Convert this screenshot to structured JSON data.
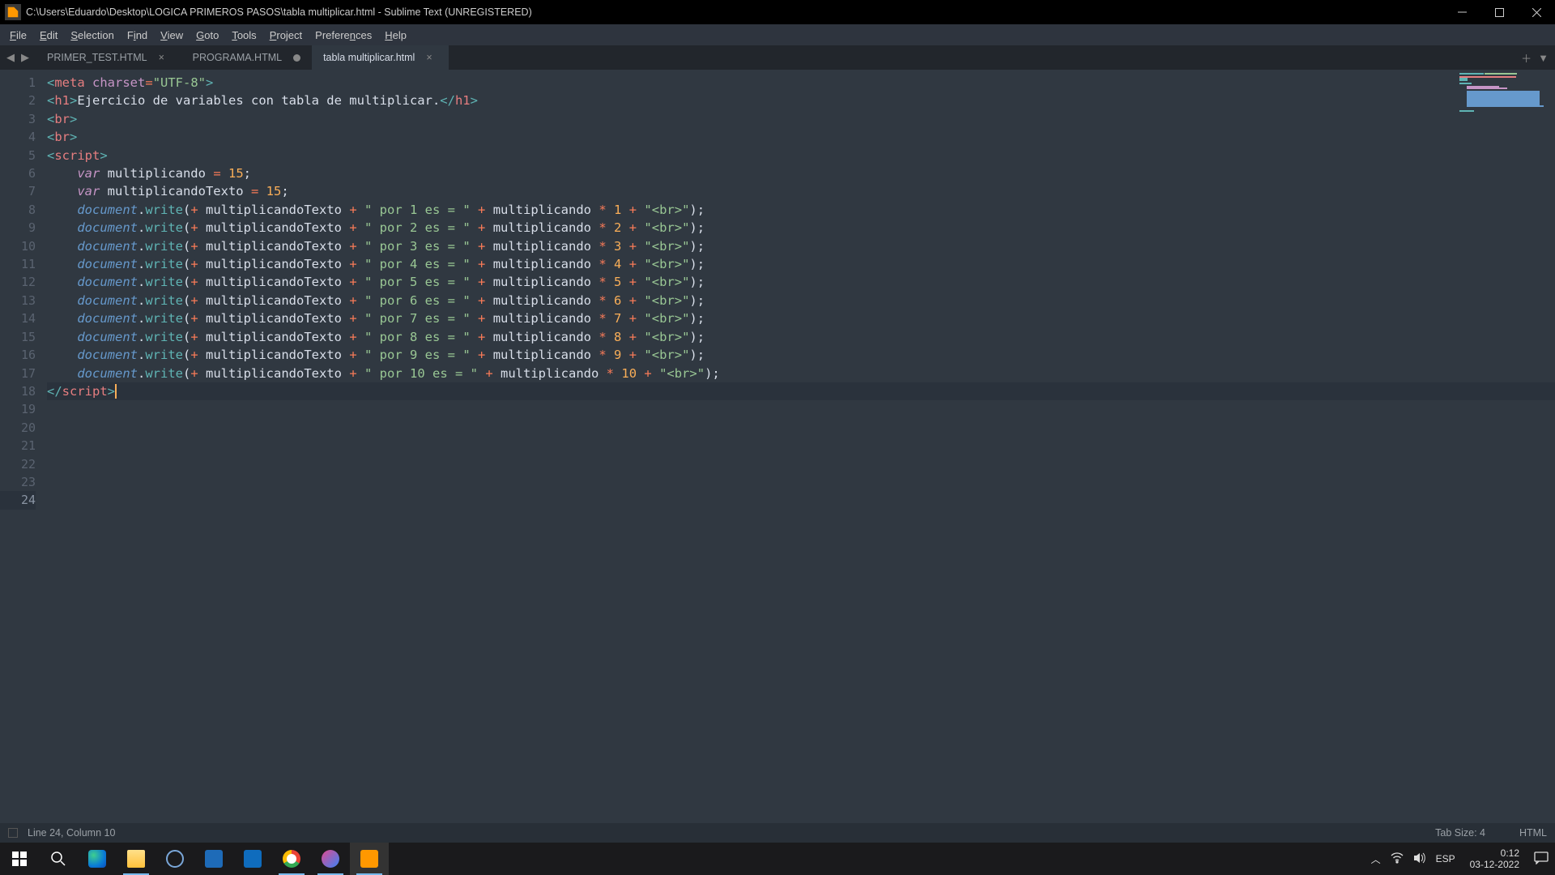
{
  "window": {
    "title": "C:\\Users\\Eduardo\\Desktop\\LOGICA PRIMEROS PASOS\\tabla multiplicar.html - Sublime Text (UNREGISTERED)"
  },
  "menu": [
    "File",
    "Edit",
    "Selection",
    "Find",
    "View",
    "Goto",
    "Tools",
    "Project",
    "Preferences",
    "Help"
  ],
  "tabs": [
    {
      "label": "PRIMER_TEST.HTML",
      "active": false,
      "dirty": false
    },
    {
      "label": "PROGRAMA.HTML",
      "active": false,
      "dirty": true
    },
    {
      "label": "tabla multiplicar.html",
      "active": true,
      "dirty": false
    }
  ],
  "status": {
    "left": "Line 24, Column 10",
    "tabsize": "Tab Size: 4",
    "syntax": "HTML"
  },
  "code_lines": 24,
  "tray": {
    "lang": "ESP",
    "time": "0:12",
    "date": "03-12-2022"
  },
  "source": {
    "l1_charset": "\"UTF-8\"",
    "h1_text": "Ejercicio de variables con tabla de multiplicar.",
    "var1_name": "multiplicando",
    "var1_val": "15",
    "var2_name": "multiplicandoTexto",
    "var2_val": "15",
    "dw": [
      {
        "mid": "\" por 1 es = \"",
        "mult": "1",
        "br": "\"<br>\""
      },
      {
        "mid": "\" por 2 es = \"",
        "mult": "2",
        "br": "\"<br>\""
      },
      {
        "mid": "\" por 3 es = \"",
        "mult": "3",
        "br": "\"<br>\""
      },
      {
        "mid": "\" por 4 es = \"",
        "mult": "4",
        "br": "\"<br>\""
      },
      {
        "mid": "\" por 5 es = \"",
        "mult": "5",
        "br": "\"<br>\""
      },
      {
        "mid": "\" por 6 es = \"",
        "mult": "6",
        "br": "\"<br>\""
      },
      {
        "mid": "\" por 7 es = \"",
        "mult": "7",
        "br": "\"<br>\""
      },
      {
        "mid": "\" por 8 es = \"",
        "mult": "8",
        "br": "\"<br>\""
      },
      {
        "mid": "\" por 9 es = \"",
        "mult": "9",
        "br": "\"<br>\""
      },
      {
        "mid": "\" por 10 es = \"",
        "mult": "10",
        "br": "\"<br>\""
      }
    ]
  }
}
